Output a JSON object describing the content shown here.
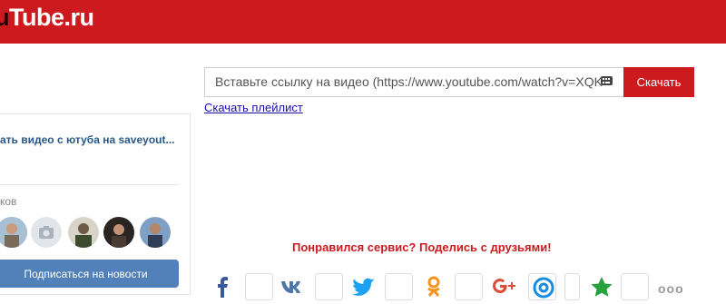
{
  "header": {
    "logo_prefix": "u",
    "logo_main": "Tube.ru",
    "bg_color": "#cc1a1f"
  },
  "widget": {
    "title": "ать видео с ютуба на saveyout...",
    "members_label": "ков",
    "subscribe_label": "Подписаться на новости",
    "avatars": [
      "avatar-person",
      "camera-placeholder-icon",
      "avatar-person",
      "avatar-person",
      "avatar-person"
    ]
  },
  "search": {
    "placeholder": "Вставьте ссылку на видео (https://www.youtube.com/watch?v=XQK",
    "button_label": "Скачать",
    "keyboard_icon": "keyboard-icon"
  },
  "playlist_link": "Скачать плейлист",
  "share": {
    "title": "Понравился сервис? Поделись с друзьями!",
    "networks": [
      "facebook-icon",
      "vk-icon",
      "twitter-icon",
      "odnoklassniki-icon",
      "google-plus-icon",
      "mailru-icon",
      "moimir-icon"
    ],
    "more_label": "ооо"
  }
}
